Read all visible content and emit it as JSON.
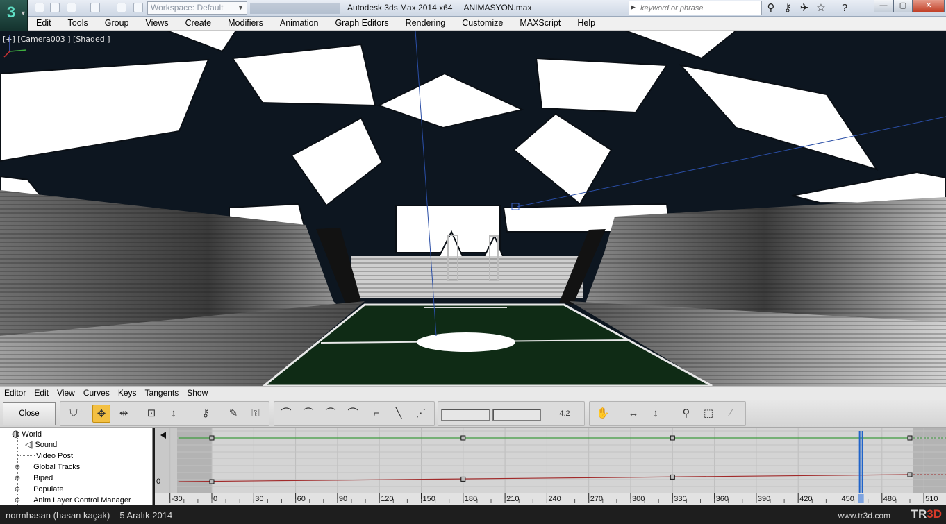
{
  "titlebar": {
    "workspace": "Workspace: Default",
    "app_title": "Autodesk 3ds Max  2014 x64",
    "file_name": "ANIMASYON.max",
    "search_placeholder": "keyword or phrase",
    "logo_glyph": "3",
    "window_buttons": [
      "—",
      "▢",
      "✕"
    ]
  },
  "menu": [
    "Edit",
    "Tools",
    "Group",
    "Views",
    "Create",
    "Modifiers",
    "Animation",
    "Graph Editors",
    "Rendering",
    "Customize",
    "MAXScript",
    "Help"
  ],
  "viewport": {
    "label": "[+] [Camera003 ] [Shaded ]",
    "colors": {
      "sky": "#0d1620",
      "pitch": "#0d2a14",
      "roof_panel": "#ffffff",
      "stand_light": "#bdbdbd"
    }
  },
  "curve_editor": {
    "menu": [
      "Editor",
      "Edit",
      "View",
      "Curves",
      "Keys",
      "Tangents",
      "Show"
    ],
    "close_label": "Close",
    "tools_left": [
      "filter-icon",
      "move-keys-icon",
      "slide-keys-icon",
      "scale-keys-icon",
      "scale-values-icon",
      "add-keys-icon",
      "draw-curves-icon",
      "reduce-keys-icon"
    ],
    "tangent_tools": [
      "auto-tangent-icon",
      "custom-tangent-icon",
      "fast-tangent-icon",
      "slow-tangent-icon",
      "step-tangent-icon",
      "linear-tangent-icon",
      "smooth-tangent-icon"
    ],
    "frame_value_1": "",
    "frame_value_2": "",
    "lock_value": "4.2",
    "view_tools": [
      "pan-icon",
      "frame-horizontal-icon",
      "frame-value-icon",
      "zoom-icon",
      "zoom-region-icon",
      "isolate-curve-icon"
    ],
    "tree": [
      {
        "label": "World",
        "icon": "globe-icon",
        "level": 0,
        "expander": false
      },
      {
        "label": "Sound",
        "icon": "speaker-icon",
        "level": 1,
        "expander": false
      },
      {
        "label": "Video Post",
        "icon": "",
        "level": 1,
        "expander": false
      },
      {
        "label": "Global Tracks",
        "icon": "",
        "level": 1,
        "expander": true
      },
      {
        "label": "Biped",
        "icon": "",
        "level": 1,
        "expander": true
      },
      {
        "label": "Populate",
        "icon": "",
        "level": 1,
        "expander": true
      },
      {
        "label": "Anim Layer Control Manager",
        "icon": "",
        "level": 1,
        "expander": true
      }
    ],
    "value_label": "0",
    "ruler_ticks": [
      "-30",
      "0",
      "30",
      "60",
      "90",
      "120",
      "150",
      "180",
      "210",
      "240",
      "270",
      "300",
      "330",
      "360",
      "390",
      "420",
      "450",
      "480",
      "510"
    ],
    "current_frame": 465,
    "keys_green": [
      0,
      180,
      330,
      500
    ],
    "keys_red": [
      0,
      180,
      330,
      500
    ],
    "curve_colors": {
      "green": "#3f9a3f",
      "red": "#a12a2a",
      "time_slider": "#1f63c9"
    }
  },
  "status": {
    "user": "normhasan (hasan kaçak)",
    "date": "5 Aralık 2014",
    "site": "www.tr3d.com",
    "logo_left": "TR",
    "logo_right": "3D"
  }
}
